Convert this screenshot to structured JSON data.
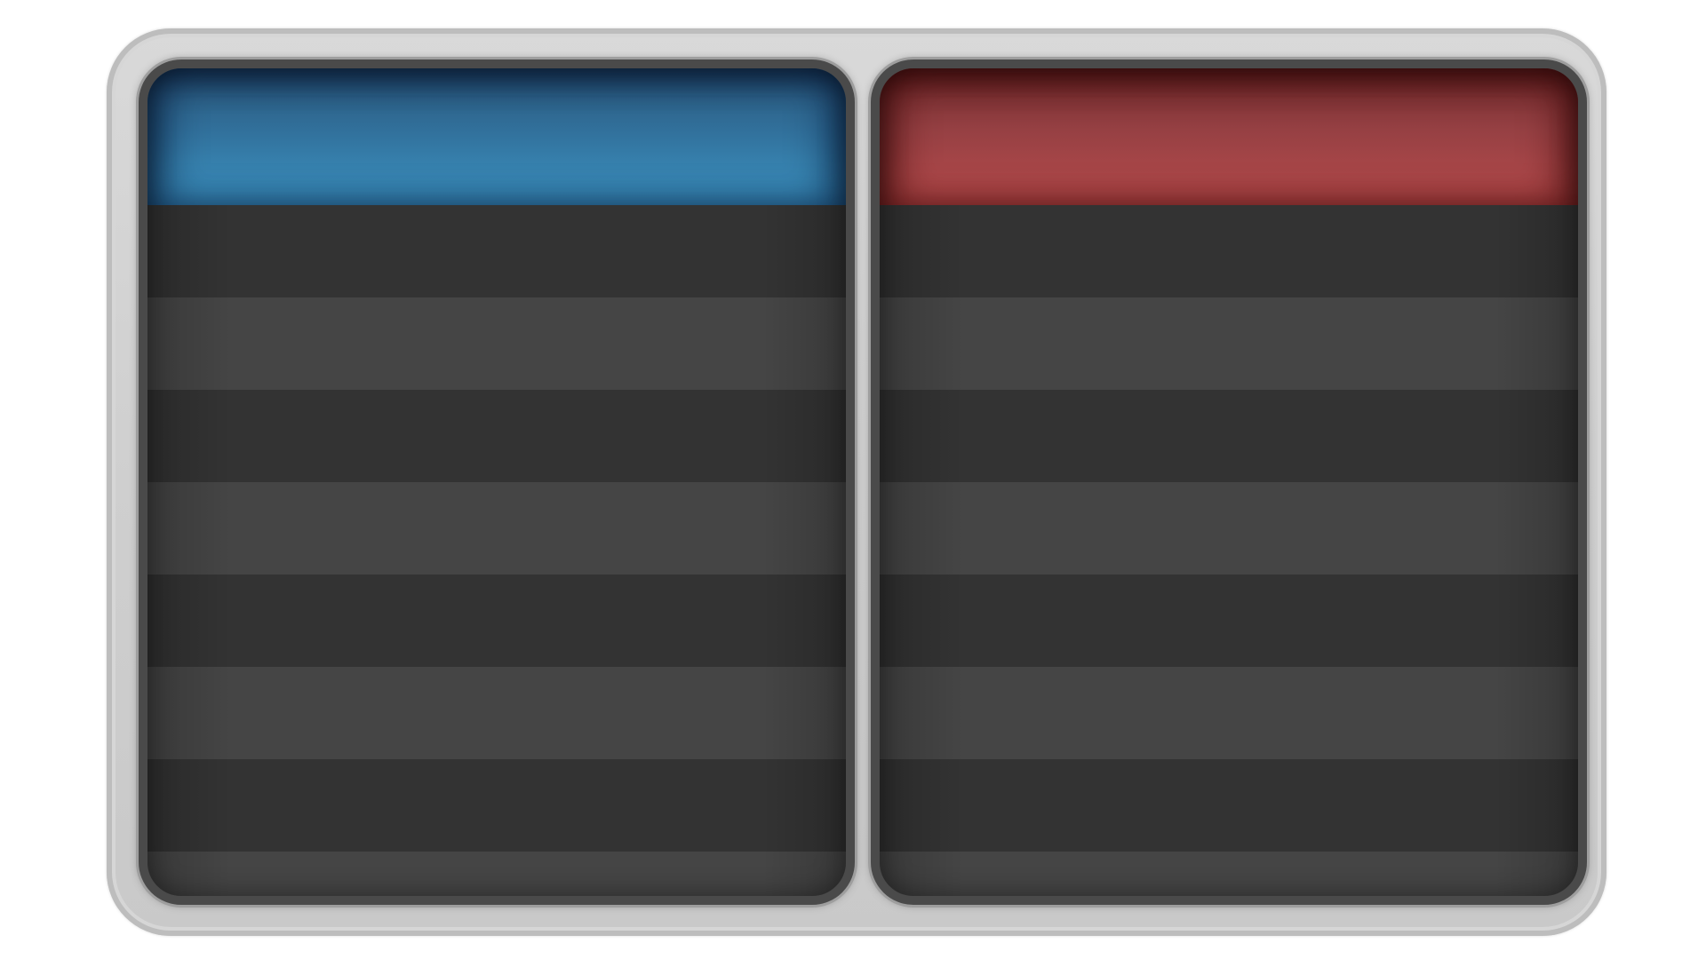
{
  "colors": {
    "left_header": "#3d94c3",
    "right_header": "#b84c4d",
    "row_dark": "#333333",
    "row_light": "#454545",
    "frame": "#d0d0d0"
  },
  "left_panel": {
    "title": "",
    "rows": [
      "",
      "",
      "",
      "",
      "",
      "",
      "",
      ""
    ]
  },
  "right_panel": {
    "title": "",
    "rows": [
      "",
      "",
      "",
      "",
      "",
      "",
      "",
      ""
    ]
  }
}
